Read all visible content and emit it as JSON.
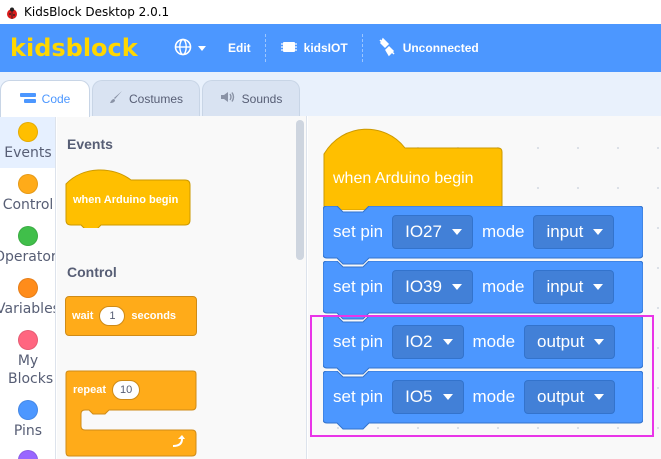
{
  "window": {
    "title": "KidsBlock Desktop 2.0.1"
  },
  "menubar": {
    "logo": "kidsblock",
    "edit_label": "Edit",
    "device_label": "kidsIOT",
    "connection_label": "Unconnected",
    "colors": {
      "bar": "#4c97ff",
      "logo": "#ffd700"
    }
  },
  "tabs": [
    {
      "label": "Code",
      "icon": "code-icon",
      "active": true
    },
    {
      "label": "Costumes",
      "icon": "brush-icon",
      "active": false
    },
    {
      "label": "Sounds",
      "icon": "speaker-icon",
      "active": false
    }
  ],
  "categories": [
    {
      "label": "Events",
      "color": "#ffbf00"
    },
    {
      "label": "Control",
      "color": "#ffab19"
    },
    {
      "label": "Operators",
      "color": "#40bf4a"
    },
    {
      "label": "Variables",
      "color": "#ff8c1a"
    },
    {
      "label": "My Blocks",
      "color": "#ff6680"
    },
    {
      "label": "Pins",
      "color": "#4c97ff"
    }
  ],
  "palette": {
    "events_heading": "Events",
    "when_begin": "when Arduino begin",
    "control_heading": "Control",
    "wait": {
      "prefix": "wait",
      "value": "1",
      "suffix": "seconds"
    },
    "repeat": {
      "prefix": "repeat",
      "value": "10"
    }
  },
  "workspace": {
    "hat_label": "when Arduino begin",
    "blocks": [
      {
        "prefix": "set pin",
        "pin": "IO27",
        "mid": "mode",
        "mode": "input"
      },
      {
        "prefix": "set pin",
        "pin": "IO39",
        "mid": "mode",
        "mode": "input"
      },
      {
        "prefix": "set pin",
        "pin": "IO2",
        "mid": "mode",
        "mode": "output"
      },
      {
        "prefix": "set pin",
        "pin": "IO5",
        "mid": "mode",
        "mode": "output"
      }
    ],
    "colors": {
      "hat": "#ffbf00",
      "pin_block": "#4c97ff",
      "highlight": "#e935e8"
    }
  }
}
